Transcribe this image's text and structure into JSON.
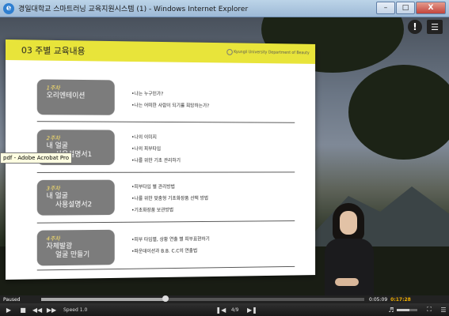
{
  "window": {
    "title": "경일대학교 스마트러닝 교육지원시스템 (1) - Windows Internet Explorer",
    "minimize_glyph": "–",
    "maximize_glyph": "□",
    "close_glyph": "X",
    "app_icon": "ie-icon"
  },
  "player_top": {
    "info_glyph": "!",
    "menu_glyph": "☰"
  },
  "slide": {
    "title": "03  주별 교육내용",
    "logo_text": "Kyungil University Department of Beauty",
    "weeks": [
      {
        "num": "1주차",
        "title": "오리엔테이션",
        "bullets": [
          "나는 누구인가?",
          "나는 어떠한 사람이 되기를 희망하는가?"
        ]
      },
      {
        "num": "2주차",
        "title": "내 얼굴\n    사용설명서1",
        "bullets": [
          "나의 이미지",
          "나의 피부타입",
          "나를 위한 기초 관리하기"
        ]
      },
      {
        "num": "3주차",
        "title": "내 얼굴\n    사용설명서2",
        "bullets": [
          "피부타입 별 관리방법",
          "나를 위한 맞춤형 기초화장품 선택 방법",
          "기초화장품 보관방법"
        ]
      },
      {
        "num": "4주차",
        "title": "자체발광\n    얼굴 만들기",
        "bullets": [
          "피부 타입별, 상황 연출 별 피부표현하기",
          "파운데이션과 B.B. C.C의 연출법"
        ]
      }
    ]
  },
  "tooltip": "pdf - Adobe Acrobat Pro",
  "player": {
    "status": "Paused",
    "progress": 0.385,
    "elapsed": "0:05:09",
    "total": "0:17:28",
    "speed_label": "Speed 1.0",
    "page": "4/9",
    "volume": 0.6
  }
}
